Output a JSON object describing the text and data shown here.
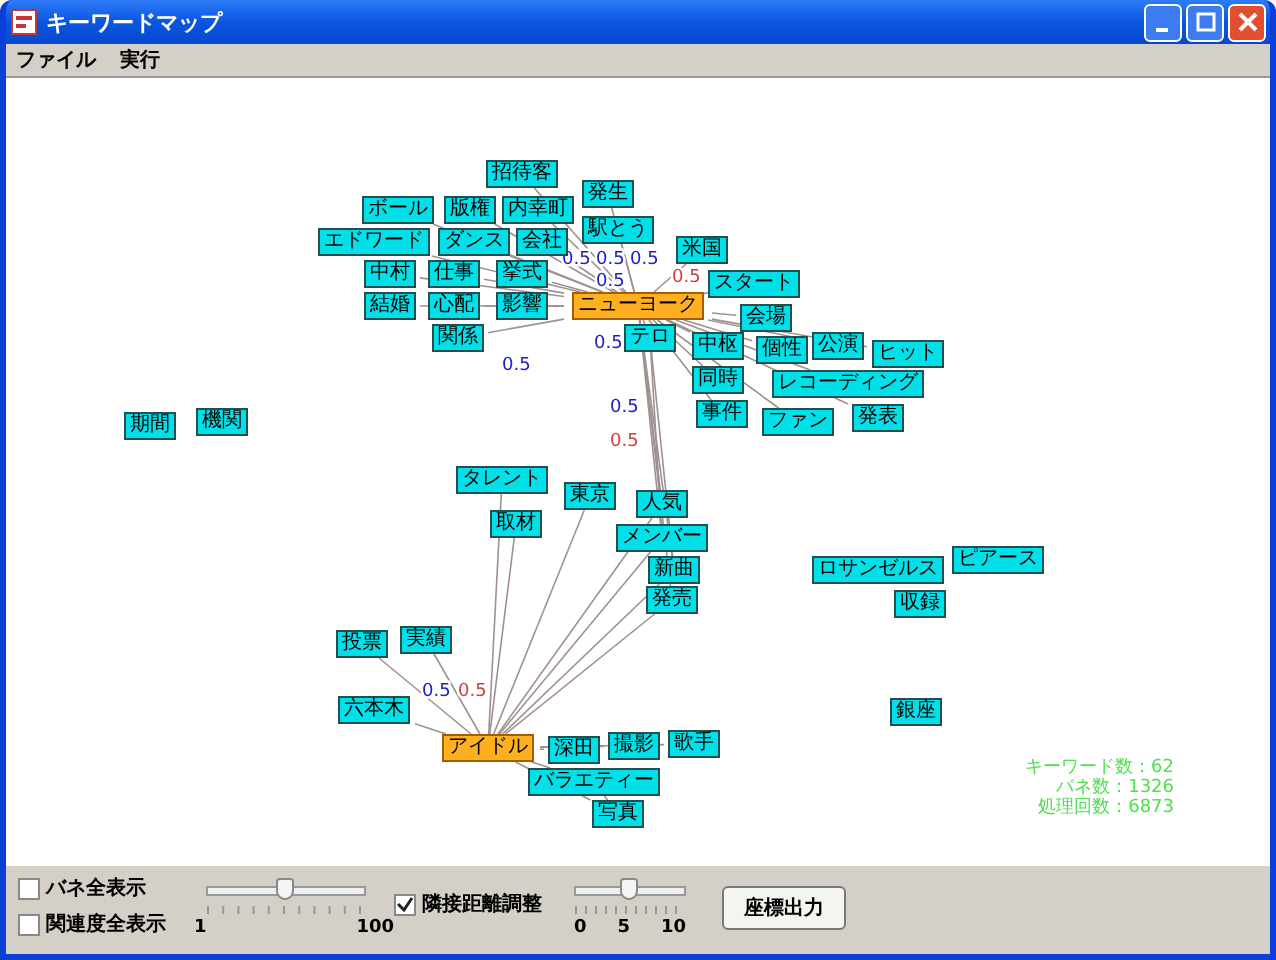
{
  "window": {
    "title": "キーワードマップ"
  },
  "menu": [
    "ファイル",
    "実行"
  ],
  "nodes": [
    {
      "label": "招待客",
      "hub": false
    },
    {
      "label": "発生",
      "hub": false
    },
    {
      "label": "ボール",
      "hub": false
    },
    {
      "label": "版権",
      "hub": false
    },
    {
      "label": "内幸町",
      "hub": false
    },
    {
      "label": "エドワード",
      "hub": false
    },
    {
      "label": "ダンス",
      "hub": false
    },
    {
      "label": "会社",
      "hub": false
    },
    {
      "label": "駅とう",
      "hub": false
    },
    {
      "label": "米国",
      "hub": false
    },
    {
      "label": "中村",
      "hub": false
    },
    {
      "label": "仕事",
      "hub": false
    },
    {
      "label": "挙式",
      "hub": false
    },
    {
      "label": "スタート",
      "hub": false
    },
    {
      "label": "結婚",
      "hub": false
    },
    {
      "label": "心配",
      "hub": false
    },
    {
      "label": "影響",
      "hub": false
    },
    {
      "label": "ニューヨーク",
      "hub": true
    },
    {
      "label": "会場",
      "hub": false
    },
    {
      "label": "関係",
      "hub": false
    },
    {
      "label": "テロ",
      "hub": false
    },
    {
      "label": "中枢",
      "hub": false
    },
    {
      "label": "個性",
      "hub": false
    },
    {
      "label": "公演",
      "hub": false
    },
    {
      "label": "ヒット",
      "hub": false
    },
    {
      "label": "同時",
      "hub": false
    },
    {
      "label": "レコーディング",
      "hub": false
    },
    {
      "label": "事件",
      "hub": false
    },
    {
      "label": "ファン",
      "hub": false
    },
    {
      "label": "発表",
      "hub": false
    },
    {
      "label": "期間",
      "hub": false
    },
    {
      "label": "機関",
      "hub": false
    },
    {
      "label": "タレント",
      "hub": false
    },
    {
      "label": "東京",
      "hub": false
    },
    {
      "label": "人気",
      "hub": false
    },
    {
      "label": "取材",
      "hub": false
    },
    {
      "label": "メンバー",
      "hub": false
    },
    {
      "label": "新曲",
      "hub": false
    },
    {
      "label": "発売",
      "hub": false
    },
    {
      "label": "ロサンゼルス",
      "hub": false
    },
    {
      "label": "ピアース",
      "hub": false
    },
    {
      "label": "収録",
      "hub": false
    },
    {
      "label": "投票",
      "hub": false
    },
    {
      "label": "実績",
      "hub": false
    },
    {
      "label": "六本木",
      "hub": false
    },
    {
      "label": "銀座",
      "hub": false
    },
    {
      "label": "アイドル",
      "hub": true
    },
    {
      "label": "深田",
      "hub": false
    },
    {
      "label": "撮影",
      "hub": false
    },
    {
      "label": "歌手",
      "hub": false
    },
    {
      "label": "バラエティー",
      "hub": false
    },
    {
      "label": "写真",
      "hub": false
    }
  ],
  "edge_labels": [
    {
      "text": "0.5",
      "color": "#2020c0"
    },
    {
      "text": "0.5",
      "color": "#2020c0"
    },
    {
      "text": "0.5",
      "color": "#2020c0"
    },
    {
      "text": "0.5",
      "color": "#2020c0"
    },
    {
      "text": "0.5",
      "color": "#2020c0"
    },
    {
      "text": "0.5",
      "color": "#d04040"
    },
    {
      "text": "0.5",
      "color": "#2020c0"
    },
    {
      "text": "0.5",
      "color": "#d04040"
    },
    {
      "text": "0.5",
      "color": "#2020c0"
    },
    {
      "text": "0.5",
      "color": "#2020c0"
    },
    {
      "text": "0.5",
      "color": "#d04040"
    }
  ],
  "stats": [
    "キーワード数：62",
    "バネ数：1326",
    "処理回数：6873"
  ],
  "controls": {
    "show_springs": {
      "label": "バネ全表示",
      "checked": false
    },
    "show_relevance": {
      "label": "関連度全表示",
      "checked": false
    },
    "slider1": {
      "level": 0.5,
      "ticks": [
        "1",
        "100"
      ]
    },
    "adjust_distance": {
      "label": "隣接距離調整",
      "checked": true
    },
    "slider2": {
      "level": 0.5,
      "ticks": [
        "0",
        "5",
        "10"
      ]
    },
    "export_button": "座標出力"
  }
}
